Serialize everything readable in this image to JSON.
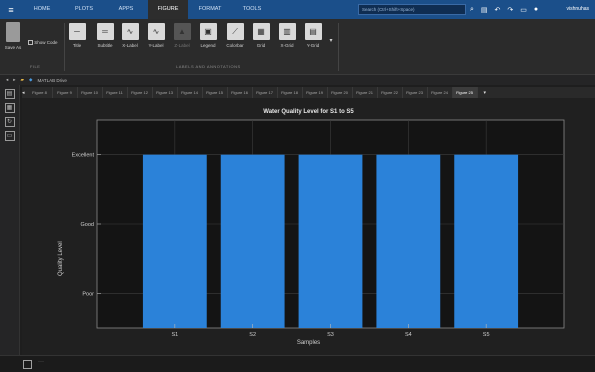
{
  "app": {
    "menu_glyph": "≡",
    "tabs": [
      "HOME",
      "PLOTS",
      "APPS",
      "FIGURE",
      "FORMAT",
      "TOOLS"
    ],
    "active_tab": "FIGURE",
    "search_placeholder": "Search (Ctrl+Shift+Space)",
    "user": "vishnuhas"
  },
  "ribbon": {
    "save_label": "Save As",
    "show_code_label": "Show Code",
    "file_section": "FILE",
    "annotation_buttons": [
      "Title",
      "Subtitle",
      "X-Label",
      "Y-Label",
      "Z-Label",
      "Legend",
      "Colorbar",
      "Grid",
      "X-Grid",
      "Y-Grid"
    ],
    "annotation_section": "LABELS AND ANNOTATIONS"
  },
  "address": {
    "path": "MATLAB Drive"
  },
  "figure_tabs": [
    "Figure 8",
    "Figure 9",
    "Figure 10",
    "Figure 11",
    "Figure 12",
    "Figure 13",
    "Figure 14",
    "Figure 15",
    "Figure 16",
    "Figure 17",
    "Figure 18",
    "Figure 19",
    "Figure 20",
    "Figure 21",
    "Figure 22",
    "Figure 23",
    "Figure 24",
    "Figure 25"
  ],
  "active_figure_tab": "Figure 25",
  "chart_data": {
    "type": "bar",
    "title": "Water Quality Level for S1 to S5",
    "xlabel": "Samples",
    "ylabel": "Quality Level",
    "categories": [
      "S1",
      "S2",
      "S3",
      "S4",
      "S5"
    ],
    "values": [
      3,
      3,
      3,
      3,
      3
    ],
    "ylim": [
      0.5,
      3.5
    ],
    "yticks": [
      1,
      2,
      3
    ],
    "ytick_labels": [
      "Poor",
      "Good",
      "Excellent"
    ],
    "grid": true,
    "bar_color": "#2b82d9",
    "axes_color": "#141414"
  }
}
